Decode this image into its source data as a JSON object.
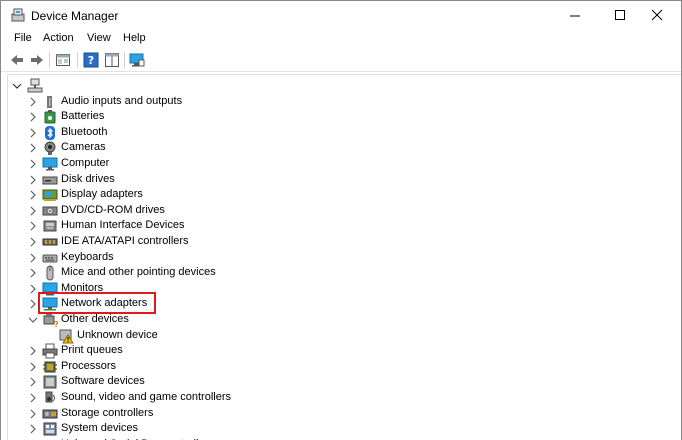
{
  "window": {
    "title": "Device Manager"
  },
  "menu": [
    {
      "label": "File"
    },
    {
      "label": "Action"
    },
    {
      "label": "View"
    },
    {
      "label": "Help"
    }
  ],
  "tree": {
    "root_label": "",
    "categories": [
      {
        "label": "Audio inputs and outputs",
        "icon": "speaker-icon",
        "expanded": false
      },
      {
        "label": "Batteries",
        "icon": "battery-icon",
        "expanded": false
      },
      {
        "label": "Bluetooth",
        "icon": "bluetooth-icon",
        "expanded": false
      },
      {
        "label": "Cameras",
        "icon": "camera-icon",
        "expanded": false
      },
      {
        "label": "Computer",
        "icon": "computer-icon",
        "expanded": false
      },
      {
        "label": "Disk drives",
        "icon": "disk-drive-icon",
        "expanded": false
      },
      {
        "label": "Display adapters",
        "icon": "display-adapter-icon",
        "expanded": false
      },
      {
        "label": "DVD/CD-ROM drives",
        "icon": "dvd-drive-icon",
        "expanded": false
      },
      {
        "label": "Human Interface Devices",
        "icon": "hid-icon",
        "expanded": false
      },
      {
        "label": "IDE ATA/ATAPI controllers",
        "icon": "ide-controller-icon",
        "expanded": false
      },
      {
        "label": "Keyboards",
        "icon": "keyboard-icon",
        "expanded": false
      },
      {
        "label": "Mice and other pointing devices",
        "icon": "mouse-icon",
        "expanded": false
      },
      {
        "label": "Monitors",
        "icon": "monitor-icon",
        "expanded": false
      },
      {
        "label": "Network adapters",
        "icon": "network-adapter-icon",
        "expanded": false,
        "highlighted": true
      },
      {
        "label": "Other devices",
        "icon": "other-devices-icon",
        "expanded": true,
        "children": [
          {
            "label": "Unknown device",
            "icon": "unknown-device-warning-icon"
          }
        ]
      },
      {
        "label": "Print queues",
        "icon": "printer-icon",
        "expanded": false
      },
      {
        "label": "Processors",
        "icon": "processor-icon",
        "expanded": false
      },
      {
        "label": "Software devices",
        "icon": "software-device-icon",
        "expanded": false
      },
      {
        "label": "Sound, video and game controllers",
        "icon": "sound-controller-icon",
        "expanded": false
      },
      {
        "label": "Storage controllers",
        "icon": "storage-controller-icon",
        "expanded": false
      },
      {
        "label": "System devices",
        "icon": "system-devices-icon",
        "expanded": false
      },
      {
        "label": "Universal Serial Bus controllers",
        "icon": "usb-icon",
        "expanded": false
      }
    ]
  },
  "colors": {
    "highlight_border": "#e0191b",
    "monitor_blue": "#2aa4e4",
    "toolbar_arrow": "#6d6d6d"
  }
}
